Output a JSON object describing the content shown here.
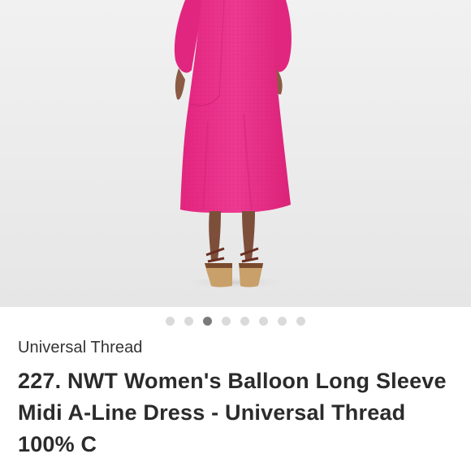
{
  "listing": {
    "brand": "Universal Thread",
    "title": "227. NWT Women's Balloon Long Sleeve Midi A-Line Dress - Universal Thread 100% C"
  },
  "carousel": {
    "count": 8,
    "active_index": 2
  },
  "photo": {
    "subject": "pink midi dress back view",
    "dress_color": "#ea2c88",
    "background_color": "#ececec"
  }
}
